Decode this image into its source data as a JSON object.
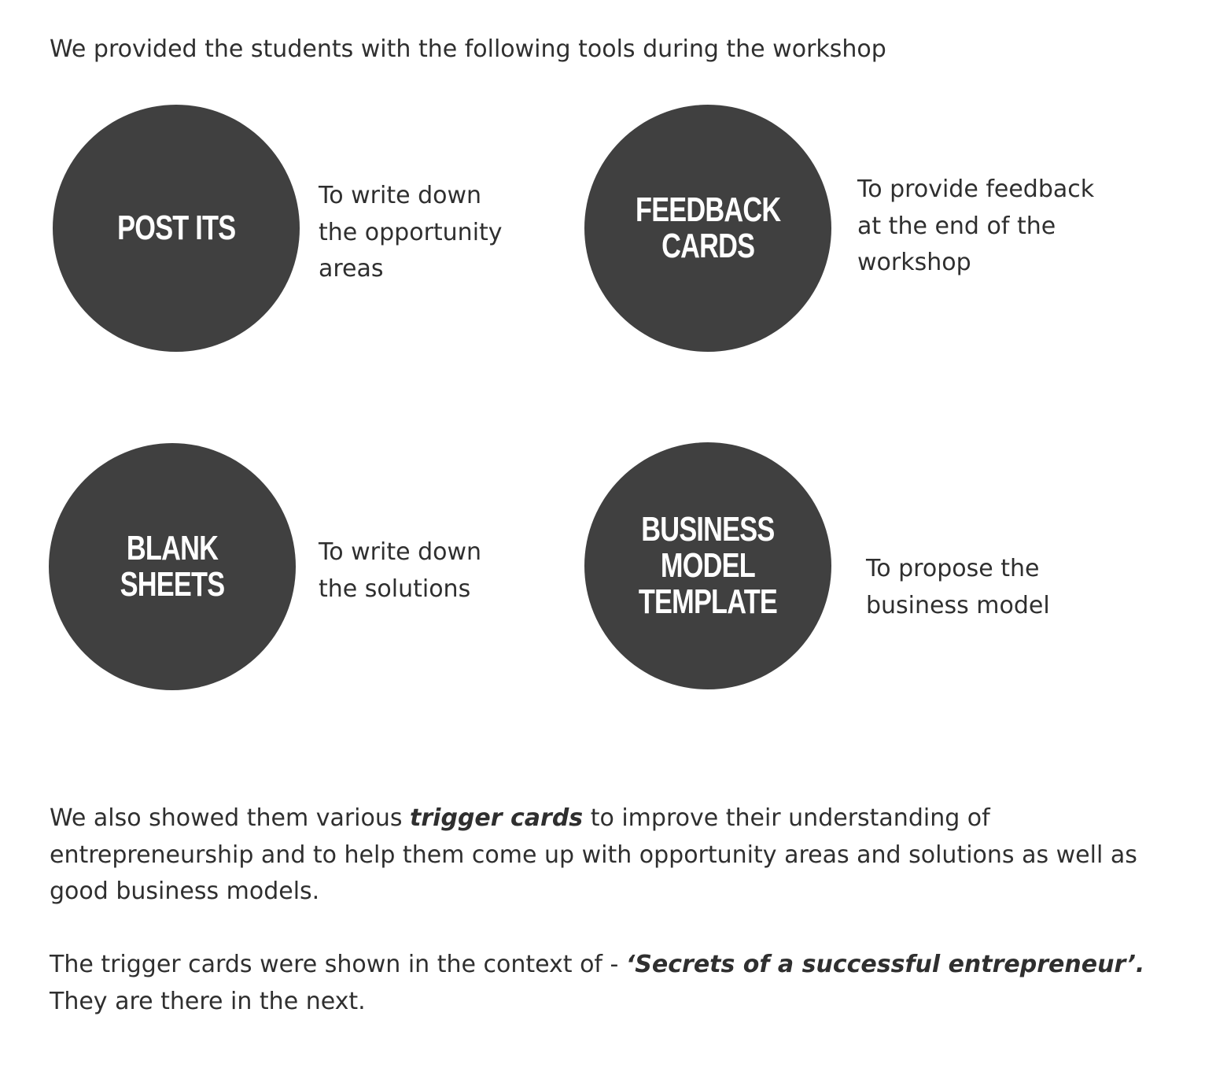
{
  "intro": "We provided the students with the following tools during the workshop",
  "tools": [
    {
      "label": "POST ITS",
      "description": "To write down\nthe opportunity\nareas"
    },
    {
      "label": "FEEDBACK\nCARDS",
      "description": "To provide feedback\nat the end of the\nworkshop"
    },
    {
      "label": "BLANK SHEETS",
      "description": "To write down\nthe solutions"
    },
    {
      "label": "BUSINESS\nMODEL\nTEMPLATE",
      "description": "To propose the\nbusiness model"
    }
  ],
  "paragraph1": {
    "before": "We also showed them various ",
    "emphasis": "trigger cards",
    "after": " to improve their understanding of entrepreneurship and to help them come up with opportunity areas and solutions as well as good business models."
  },
  "paragraph2": {
    "before": "The trigger cards were shown in the context of - ",
    "emphasis": "‘Secrets of a successful entrepreneur’.",
    "after": " They are there in the next."
  }
}
